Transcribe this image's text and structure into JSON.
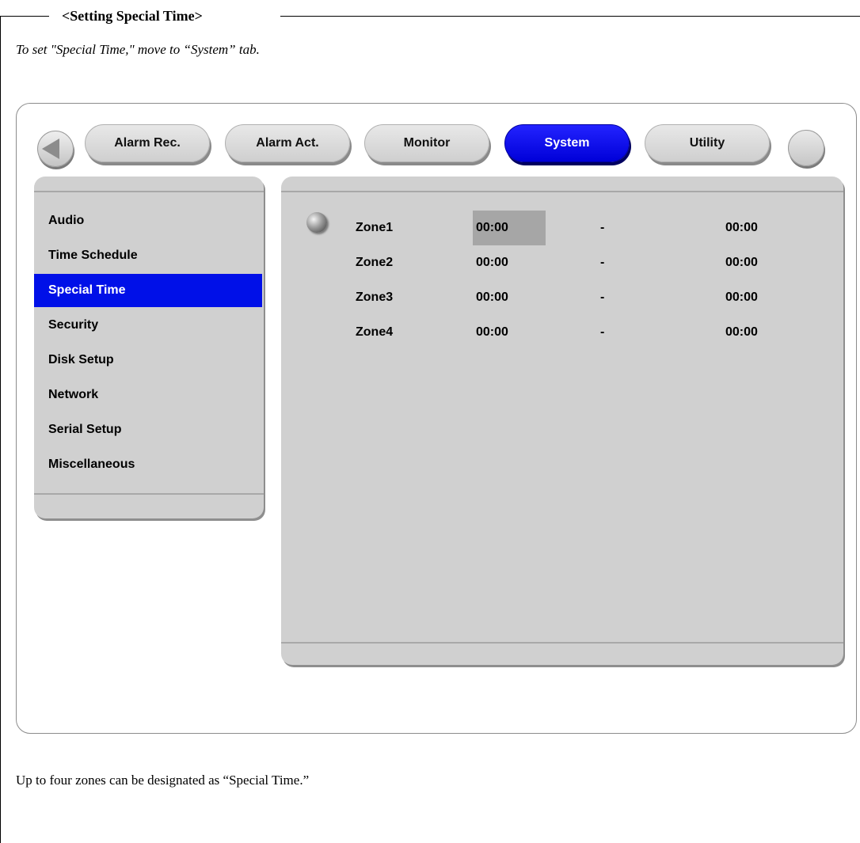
{
  "document": {
    "heading": "<Setting Special Time>",
    "intro": "To set \"Special Time,\" move to “System” tab.",
    "footer": "Up to four zones can be designated as “Special Time.”"
  },
  "tabs": [
    {
      "label": "Alarm Rec.",
      "active": false
    },
    {
      "label": "Alarm Act.",
      "active": false
    },
    {
      "label": "Monitor",
      "active": false
    },
    {
      "label": "System",
      "active": true
    },
    {
      "label": "Utility",
      "active": false
    }
  ],
  "sidebar": {
    "items": [
      {
        "label": "Audio",
        "active": false
      },
      {
        "label": "Time Schedule",
        "active": false
      },
      {
        "label": "Special Time",
        "active": true
      },
      {
        "label": "Security",
        "active": false
      },
      {
        "label": "Disk Setup",
        "active": false
      },
      {
        "label": "Network",
        "active": false
      },
      {
        "label": "Serial Setup",
        "active": false
      },
      {
        "label": "Miscellaneous",
        "active": false
      }
    ]
  },
  "zones": [
    {
      "name": "Zone1",
      "start": "00:00",
      "separator": "-",
      "end": "00:00",
      "selected": true
    },
    {
      "name": "Zone2",
      "start": "00:00",
      "separator": "-",
      "end": "00:00",
      "selected": false
    },
    {
      "name": "Zone3",
      "start": "00:00",
      "separator": "-",
      "end": "00:00",
      "selected": false
    },
    {
      "name": "Zone4",
      "start": "00:00",
      "separator": "-",
      "end": "00:00",
      "selected": false
    }
  ],
  "icons": {
    "prev": "left-arrow-icon",
    "next": "round-button-icon",
    "cursor": "ball-cursor-icon"
  },
  "colors": {
    "active_blue": "#0010e8",
    "panel_gray": "#d0d0d0",
    "selected_field": "#a6a6a6"
  }
}
